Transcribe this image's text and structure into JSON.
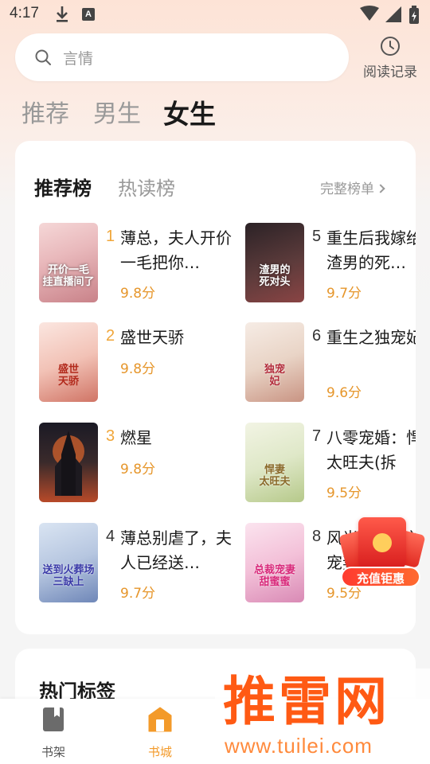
{
  "status_bar": {
    "time": "4:17",
    "notification_letter": "A"
  },
  "search": {
    "placeholder": "言情"
  },
  "history": {
    "label": "阅读记录"
  },
  "top_tabs": [
    {
      "label": "推荐",
      "active": false
    },
    {
      "label": "男生",
      "active": false
    },
    {
      "label": "女生",
      "active": true
    }
  ],
  "ranking": {
    "tabs": [
      {
        "label": "推荐榜",
        "active": true
      },
      {
        "label": "热读榜",
        "active": false
      }
    ],
    "full_list_label": "完整榜单",
    "books": [
      {
        "rank": "1",
        "title": "薄总，夫人开价一毛把你…",
        "score": "9.8分",
        "cover_text": "开价一毛\n挂直播间了"
      },
      {
        "rank": "2",
        "title": "盛世天骄",
        "score": "9.8分",
        "cover_text": "盛世\n天骄"
      },
      {
        "rank": "3",
        "title": "燃星",
        "score": "9.8分",
        "cover_text": ""
      },
      {
        "rank": "4",
        "title": "薄总别虐了，夫人已经送…",
        "score": "9.7分",
        "cover_text": "送到火葬场\n三缺上"
      },
      {
        "rank": "5",
        "title": "重生后我嫁给了渣男的死…",
        "score": "9.7分",
        "cover_text": "渣男的\n死对头"
      },
      {
        "rank": "6",
        "title": "重生之独宠妃",
        "score": "9.6分",
        "cover_text": "独宠\n妃"
      },
      {
        "rank": "7",
        "title": "八零宠婚：悍妻太旺夫(拆",
        "score": "9.5分",
        "cover_text": "悍妻\n太旺夫"
      },
      {
        "rank": "8",
        "title": "风光大嫁：总裁宠妻甜蜜蜜",
        "score": "9.5分",
        "cover_text": "总裁宠妻\n甜蜜蜜"
      }
    ]
  },
  "promo": {
    "label": "充值钜惠"
  },
  "hot_tags": {
    "title": "热门标签"
  },
  "bottom_nav": [
    {
      "label": "书架",
      "active": false
    },
    {
      "label": "书城",
      "active": true
    }
  ],
  "watermark": {
    "text": "推雷网",
    "url": "www.tuilei.com"
  },
  "colors": {
    "accent": "#f39a2a",
    "score": "#e6962b",
    "rank_top": "#f0a63a",
    "watermark": "#ff5a14"
  }
}
